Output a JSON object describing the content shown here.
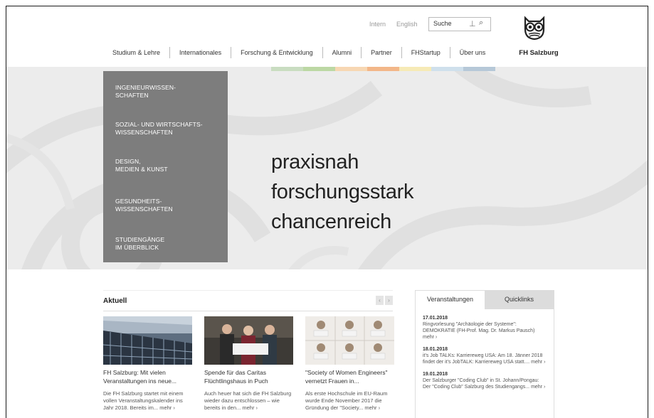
{
  "header": {
    "util_links": [
      "Intern",
      "English"
    ],
    "search": {
      "value": "Suche"
    },
    "logo_name": "FH Salzburg"
  },
  "nav": {
    "items": [
      "Studium & Lehre",
      "Internationales",
      "Forschung & Entwicklung",
      "Alumni",
      "Partner",
      "FHStartup",
      "Über uns"
    ]
  },
  "colorbar": [
    "#c9ddc1",
    "#bcd8a4",
    "#f7d7b3",
    "#f3b789",
    "#f6eab6",
    "#cfe0ec",
    "#b6c8d8"
  ],
  "hero": {
    "menu": [
      "INGENIEURWISSEN-\nSCHAFTEN",
      "SOZIAL- UND WIRTSCHAFTS-\nWISSENSCHAFTEN",
      "DESIGN,\nMEDIEN & KUNST",
      "GESUNDHEITS-\nWISSENSCHAFTEN",
      "STUDIENGÄNGE\nIM ÜBERBLICK"
    ],
    "tagline": [
      "praxisnah",
      "forschungsstark",
      "chancenreich"
    ]
  },
  "news": {
    "title": "Aktuell",
    "cards": [
      {
        "title": "FH Salzburg: Mit vielen Veranstaltungen ins neue...",
        "text": "Die FH Salzburg startet mit einem vollen Veranstaltungskalender ins Jahr 2018. Bereits im...",
        "more": "mehr ›"
      },
      {
        "title": "Spende für das Caritas Flüchtlingshaus in Puch",
        "text": "Auch heuer hat sich die FH Salzburg wieder dazu entschlossen – wie bereits in den...",
        "more": "mehr ›"
      },
      {
        "title": "\"Society of Women Engineers\" vernetzt Frauen in...",
        "text": "Als erste Hochschule im EU-Raum wurde Ende November 2017 die Gründung der \"Society...",
        "more": "mehr ›"
      }
    ]
  },
  "events": {
    "tabs": [
      "Veranstaltungen",
      "Quicklinks"
    ],
    "items": [
      {
        "date": "17.01.2018",
        "text": "Ringvorlesung \"Archäologie der Systeme\": DEMOKRATIE (FH-Prof. Mag. Dr. Markus Pausch)",
        "more": "mehr ›"
      },
      {
        "date": "18.01.2018",
        "text": "it's Job TALKs: Karriereweg USA: Am 18. Jänner 2018 findet der it's JobTALK: Karriereweg USA statt....",
        "more": "mehr ›"
      },
      {
        "date": "19.01.2018",
        "text": "Der Salzburger \"Coding Club\" in St. Johann/Pongau: Der \"Coding Club\" Salzburg des Studiengangs...",
        "more": "mehr ›"
      }
    ]
  },
  "icons": {
    "search": "search-icon",
    "keyboard": "keyboard-icon",
    "owl": "owl-logo-icon"
  }
}
